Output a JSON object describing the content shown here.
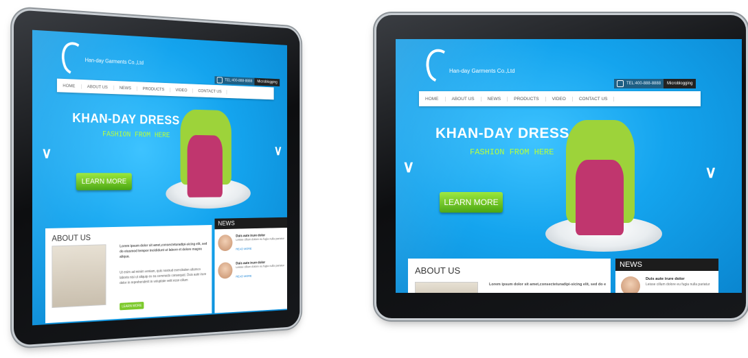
{
  "site": {
    "company": "Han-day Garments Co.,Ltd",
    "phone": "TEL:400-888-8888",
    "microblogging": "Microblogging",
    "nav": [
      "HOME",
      "ABOUT US",
      "NEWS",
      "PRODUCTS",
      "VIDEO",
      "CONTACT US"
    ],
    "headline": "KHAN-DAY DRESS",
    "tagline": "FASHION FROM HERE",
    "learn_more": "LEARN MORE",
    "about_title": "ABOUT US",
    "about_bold": "Lorem ipsum dolor sit amet,consecteturadipi-sicing elit, sed do eiusmod tempor incididunt ut labore et dolore magna aliqua.",
    "about_body": "Ut enim ad minim veniam, quis nostrud exercitation ullamco laboris nisi ut aliquip ex ea commodo consequat. Duis aute irure dolor in reprehenderit in voluptate velit esse cillum",
    "about_button": "LEARN MORE",
    "news_title": "NEWS",
    "news": [
      {
        "title": "Duis aute irure dolor",
        "snippet": "Leisse cillum dolore eu fugia nulla pariatur",
        "more": "READ MORE"
      },
      {
        "title": "Duis aute irure dolor",
        "snippet": "Leisse cillum dolore eu fugia nulla pariatur",
        "more": "READ MORE"
      }
    ]
  },
  "colors": {
    "screen_blue": "#14a4ee",
    "accent_green": "#7cc92b",
    "tagline_green": "#b6ff3a"
  }
}
